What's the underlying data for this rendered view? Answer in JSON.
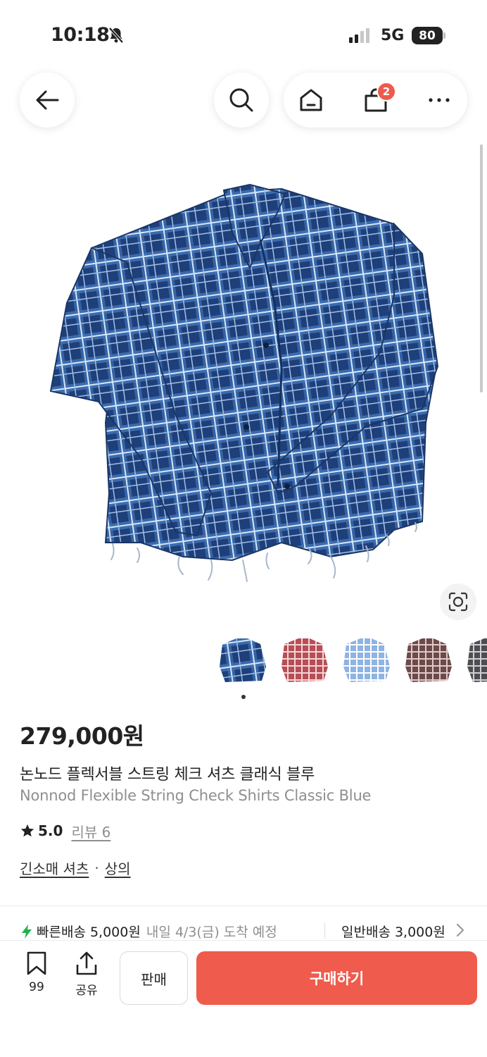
{
  "status_bar": {
    "time": "10:18",
    "network": "5G",
    "battery": "80"
  },
  "header": {
    "cart_count": "2"
  },
  "product": {
    "price": "279,000원",
    "name_ko": "논노드 플렉서블 스트링 체크 셔츠 클래식 블루",
    "name_en": "Nonnod Flexible String Check Shirts Classic Blue",
    "rating": "5.0",
    "review_label": "리뷰 6",
    "category_main": "긴소매 셔츠",
    "category_separator": "·",
    "category_sub": "상의",
    "colors": {
      "accent": "#ef5b4c",
      "fast_shipping": "#22b14c"
    }
  },
  "shipping": {
    "fast_label": "빠른배송 5,000원",
    "fast_eta": "내일 4/3(금) 도착 예정",
    "normal_label": "일반배송 3,000원"
  },
  "bottom_bar": {
    "save_count": "99",
    "share_label": "공유",
    "sell_label": "판매",
    "buy_label": "구매하기"
  },
  "thumbnails": [
    "blue-check-shirt",
    "red-check-shirt",
    "light-blue-check-shirt",
    "brown-check-shirt",
    "gray-check-shirt"
  ]
}
